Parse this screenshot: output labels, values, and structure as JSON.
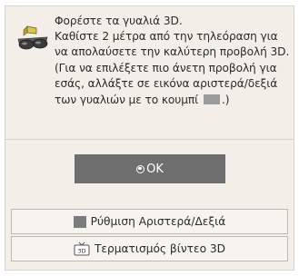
{
  "dialog": {
    "title": "Φορέστε τα γυαλιά 3D.",
    "text_part1": "Καθίστε 2 μέτρα από την τηλεόραση για να απολαύσετε την καλύτερη προβολή 3D. (Για να επιλέξετε πιο άνετη προβολή για εσάς, αλλάξτε σε εικόνα αριστερά/δεξιά των γυαλιών με το κουμπί",
    "text_part2": ".)"
  },
  "buttons": {
    "ok_label": "OK",
    "lr_setting_label": "Ρύθμιση Αριστερά/Δεξιά",
    "end_3d_label": "Τερματισμός βίντεο 3D"
  },
  "icons": {
    "glasses": "3d-glasses-icon",
    "ok": "ok-circle-icon",
    "lr": "gray-square-icon",
    "tv": "tv-3d-icon",
    "inline_key": "gray-key-icon"
  }
}
